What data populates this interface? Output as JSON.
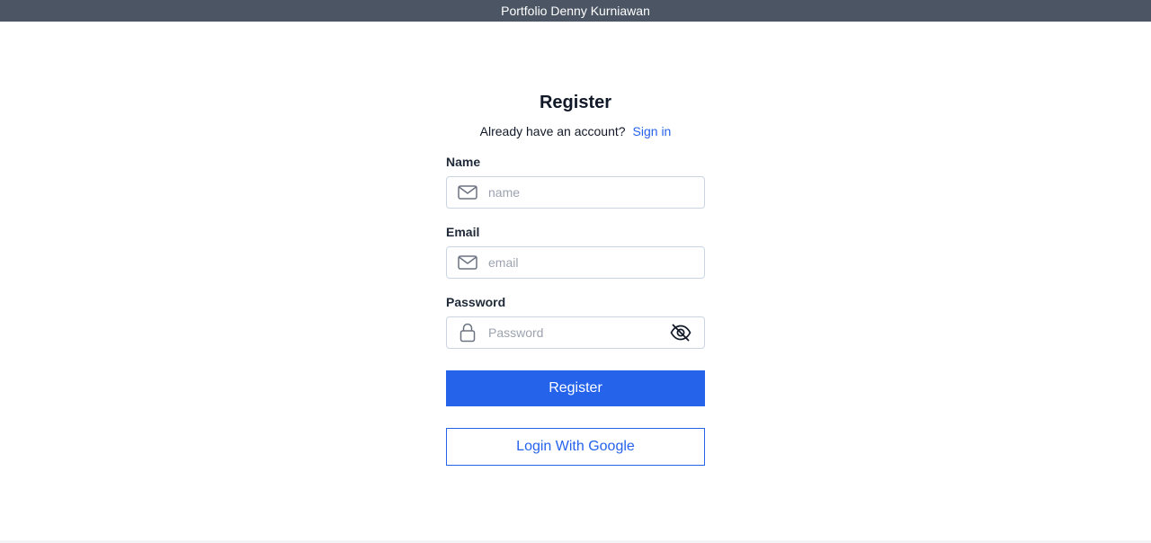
{
  "header": {
    "title": "Portfolio Denny Kurniawan",
    "background": "#4b5563"
  },
  "form": {
    "title": "Register",
    "subtitle": "Already have an account?",
    "signin_link": "Sign in",
    "fields": {
      "name": {
        "label": "Name",
        "placeholder": "name",
        "value": "",
        "icon": "mail-icon"
      },
      "email": {
        "label": "Email",
        "placeholder": "email",
        "value": "",
        "icon": "mail-icon"
      },
      "password": {
        "label": "Password",
        "placeholder": "Password",
        "value": "",
        "icon": "lock-icon",
        "toggle_icon": "eye-off-icon"
      }
    },
    "register_button": "Register",
    "google_button": "Login With Google"
  },
  "colors": {
    "accent": "#2563eb",
    "border": "#cbd5e1",
    "placeholder": "#9ca3af"
  }
}
